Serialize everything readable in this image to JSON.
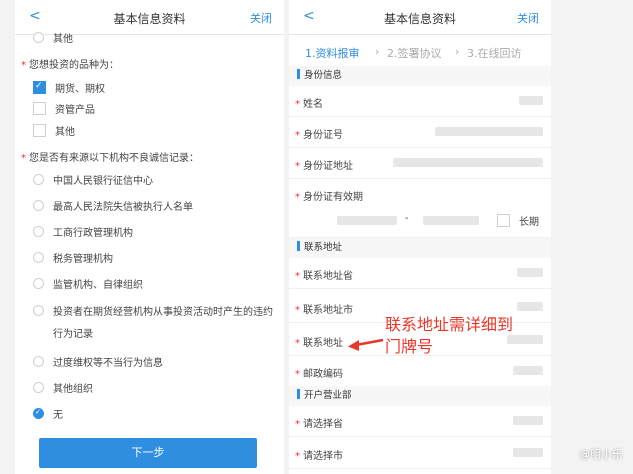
{
  "left": {
    "header": {
      "back": "<",
      "title": "基本信息资料",
      "close": "关闭"
    },
    "cutoff_option": "其他",
    "q1": "您想投资的品种为：",
    "q1_options": [
      {
        "label": "期货、期权",
        "checked": true
      },
      {
        "label": "资管产品",
        "checked": false
      },
      {
        "label": "其他",
        "checked": false
      }
    ],
    "q2": "您是否有来源以下机构不良诚信记录：",
    "q2_options": [
      {
        "label": "中国人民银行征信中心",
        "checked": false
      },
      {
        "label": "最高人民法院失信被执行人名单",
        "checked": false
      },
      {
        "label": "工商行政管理机构",
        "checked": false
      },
      {
        "label": "税务管理机构",
        "checked": false
      },
      {
        "label": "监管机构、自律组织",
        "checked": false
      },
      {
        "label": "投资者在期货经营机构从事投资活动时产生的违约",
        "label2": "行为记录",
        "checked": false
      },
      {
        "label": "过度维权等不当行为信息",
        "checked": false
      },
      {
        "label": "其他组织",
        "checked": false
      },
      {
        "label": "无",
        "checked": true
      }
    ],
    "next_button": "下一步"
  },
  "right": {
    "header": {
      "back": "<",
      "title": "基本信息资料",
      "close": "关闭"
    },
    "steps": [
      "1.资料报审",
      "2.签署协议",
      "3.在线回访"
    ],
    "sections": {
      "identity": "身份信息",
      "contact": "联系地址",
      "branch": "开户营业部"
    },
    "fields": {
      "name": "姓名",
      "id_number": "身份证号",
      "id_address": "身份证地址",
      "id_validity": "身份证有效期",
      "validity_dash": "-",
      "long_term": "长期",
      "contact_province": "联系地址省",
      "contact_city": "联系地址市",
      "contact_address": "联系地址",
      "postcode": "邮政编码",
      "select_province": "请选择省",
      "select_city": "请选择市"
    }
  },
  "annotation": {
    "line1": "联系地址需详细到",
    "line2": "门牌号",
    "color": "#e8372a"
  },
  "watermark": "@明小乐",
  "colors": {
    "accent": "#2f8ee0",
    "required": "#e33"
  }
}
